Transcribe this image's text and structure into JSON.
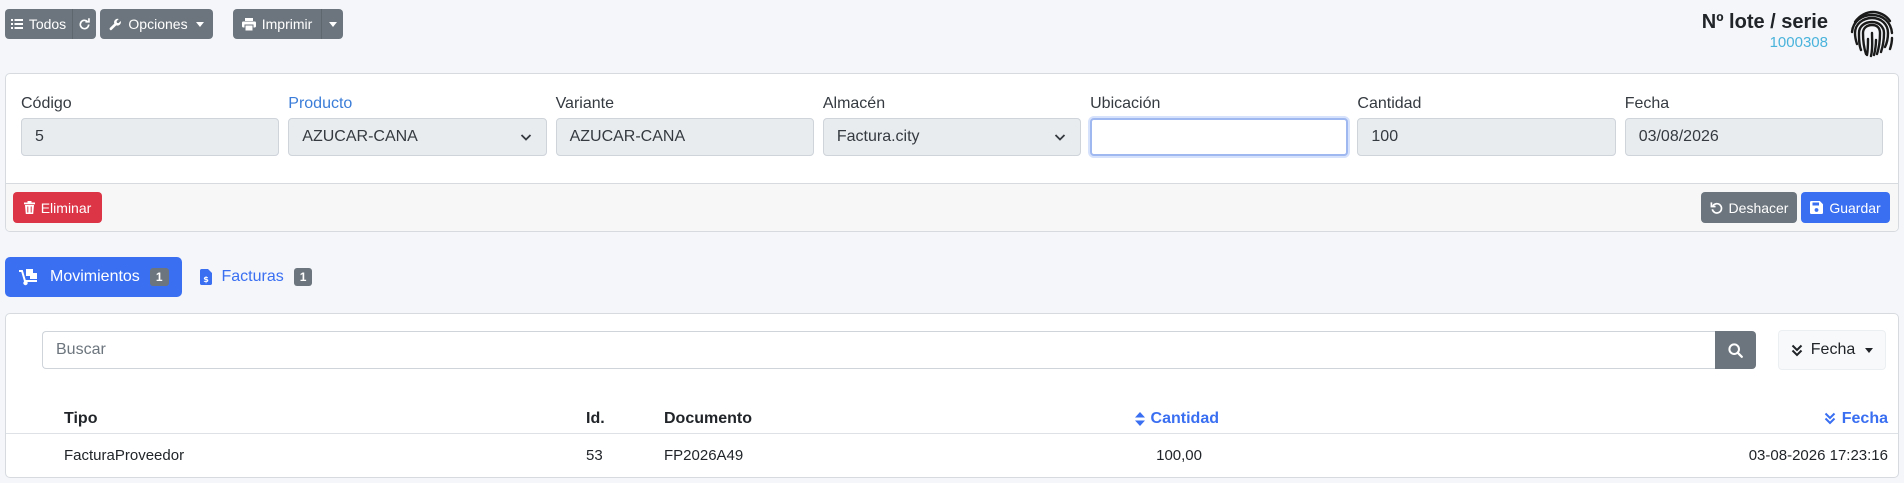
{
  "toolbar": {
    "todos_label": "Todos",
    "opciones_label": "Opciones",
    "imprimir_label": "Imprimir"
  },
  "header": {
    "title": "Nº lote / serie",
    "serial": "1000308"
  },
  "form": {
    "codigo": {
      "label": "Código",
      "value": "5"
    },
    "producto": {
      "label": "Producto",
      "value": "AZUCAR-CANA"
    },
    "variante": {
      "label": "Variante",
      "value": "AZUCAR-CANA"
    },
    "almacen": {
      "label": "Almacén",
      "value": "Factura.city"
    },
    "ubicacion": {
      "label": "Ubicación",
      "value": ""
    },
    "cantidad": {
      "label": "Cantidad",
      "value": "100"
    },
    "fecha": {
      "label": "Fecha",
      "value": "03/08/2026"
    },
    "eliminar_label": "Eliminar",
    "deshacer_label": "Deshacer",
    "guardar_label": "Guardar"
  },
  "tabs": [
    {
      "label": "Movimientos",
      "count": "1",
      "active": true
    },
    {
      "label": "Facturas",
      "count": "1",
      "active": false
    }
  ],
  "list": {
    "search_placeholder": "Buscar",
    "sort_label": "Fecha",
    "columns": {
      "tipo": "Tipo",
      "id": "Id.",
      "documento": "Documento",
      "cantidad": "Cantidad",
      "fecha": "Fecha"
    },
    "rows": [
      {
        "tipo": "FacturaProveedor",
        "id": "53",
        "documento": "FP2026A49",
        "cantidad": "100,00",
        "fecha": "03-08-2026 17:23:16"
      }
    ]
  },
  "colors": {
    "primary": "#3a6ff2",
    "secondary": "#6c757d",
    "danger": "#dc3545",
    "serial": "#4ab3dc"
  }
}
